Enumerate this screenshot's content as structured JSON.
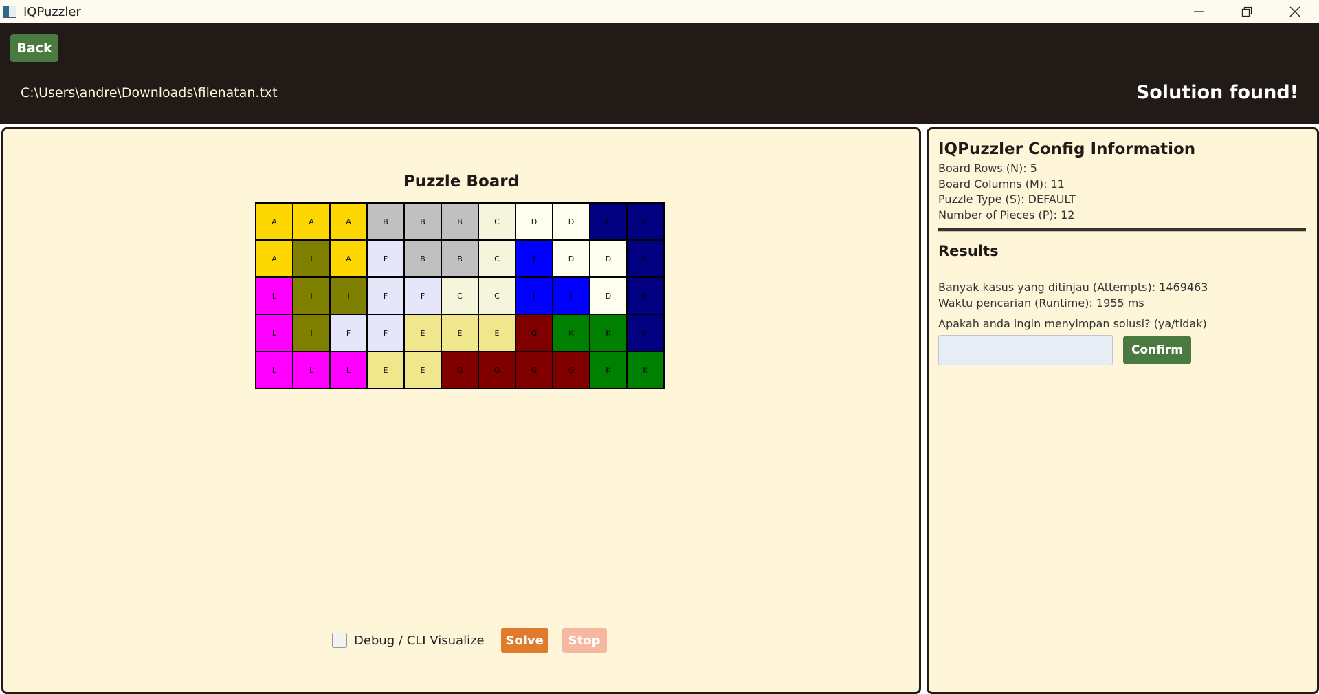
{
  "window": {
    "title": "IQPuzzler",
    "controls": [
      "minimize-icon",
      "restore-icon",
      "close-icon"
    ]
  },
  "header": {
    "back_label": "Back",
    "file_path": "C:\\Users\\andre\\Downloads\\filenatan.txt",
    "status": "Solution found!"
  },
  "board": {
    "title": "Puzzle Board",
    "rows": 5,
    "cols": 11,
    "cells": [
      [
        "A",
        "A",
        "A",
        "B",
        "B",
        "B",
        "C",
        "D",
        "D",
        "H",
        "H"
      ],
      [
        "A",
        "I",
        "A",
        "F",
        "B",
        "B",
        "C",
        "J",
        "D",
        "D",
        "H"
      ],
      [
        "L",
        "I",
        "I",
        "F",
        "F",
        "C",
        "C",
        "J",
        "J",
        "D",
        "H"
      ],
      [
        "L",
        "I",
        "F",
        "F",
        "E",
        "E",
        "E",
        "G",
        "K",
        "K",
        "H"
      ],
      [
        "L",
        "L",
        "L",
        "E",
        "E",
        "G",
        "G",
        "G",
        "G",
        "K",
        "K"
      ]
    ],
    "colors": {
      "A": "#ffd700",
      "B": "#c0c0c0",
      "C": "#f5f5dc",
      "D": "#fffff0",
      "E": "#f0e68c",
      "F": "#e6e6fa",
      "G": "#800000",
      "H": "#000080",
      "I": "#808000",
      "J": "#0000ff",
      "K": "#008000",
      "L": "#ff00ff"
    }
  },
  "controls": {
    "debug_label": "Debug / CLI Visualize",
    "debug_checked": false,
    "solve_label": "Solve",
    "stop_label": "Stop"
  },
  "config": {
    "title": "IQPuzzler Config Information",
    "rows": "Board Rows (N): 5",
    "cols": "Board Columns (M): 11",
    "type": "Puzzle Type (S): DEFAULT",
    "pieces": "Number of Pieces (P): 12"
  },
  "results": {
    "title": "Results",
    "attempts": "Banyak kasus yang ditinjau (Attempts): 1469463",
    "runtime": "Waktu pencarian (Runtime): 1955 ms",
    "save_prompt": "Apakah anda ingin menyimpan solusi? (ya/tidak)",
    "save_input_value": "",
    "confirm_label": "Confirm"
  }
}
